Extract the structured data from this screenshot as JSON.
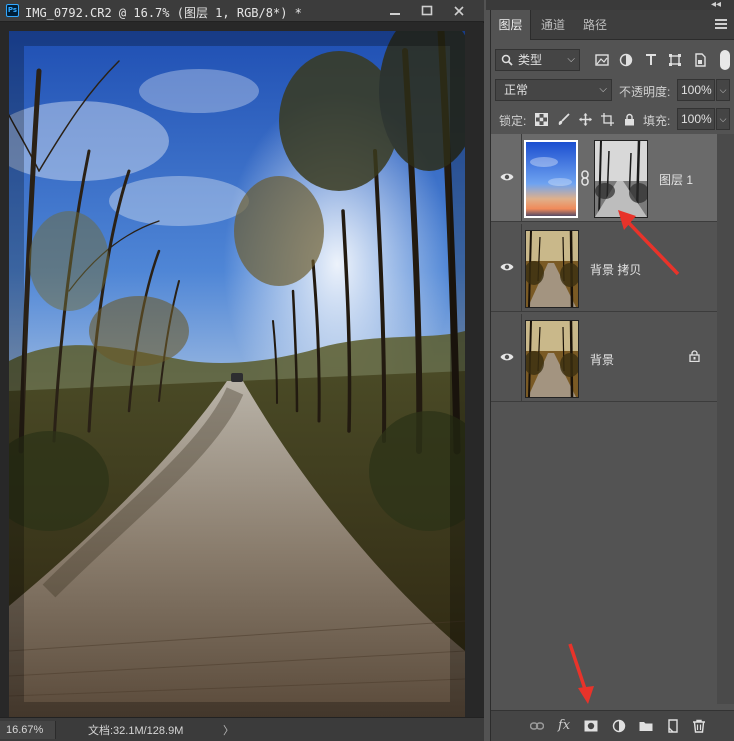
{
  "document": {
    "title": "IMG_0792.CR2 @ 16.7% (图层 1, RGB/8*) *",
    "app_badge": "Ps",
    "zoom": "16.67%",
    "doc_info": "文档:32.1M/128.9M",
    "status_arrow": "〉"
  },
  "panel": {
    "tabs": [
      {
        "label": "图层"
      },
      {
        "label": "通道"
      },
      {
        "label": "路径"
      }
    ],
    "filter_kind": "类型",
    "blend_mode": "正常",
    "opacity_label": "不透明度:",
    "opacity_value": "100%",
    "lock_label": "锁定:",
    "fill_label": "填充:",
    "fill_value": "100%",
    "layers": [
      {
        "name": "图层 1",
        "selected": true,
        "has_mask": true,
        "locked": false
      },
      {
        "name": "背景 拷贝",
        "selected": false,
        "has_mask": false,
        "locked": false
      },
      {
        "name": "背景",
        "selected": false,
        "has_mask": false,
        "locked": true
      }
    ]
  },
  "colors": {
    "app_bg": "#535353",
    "canvas_bg": "#282828",
    "selected_layer": "#6a6a6a",
    "annotation_arrow": "#e8332a",
    "accent": "#31a8ff"
  }
}
